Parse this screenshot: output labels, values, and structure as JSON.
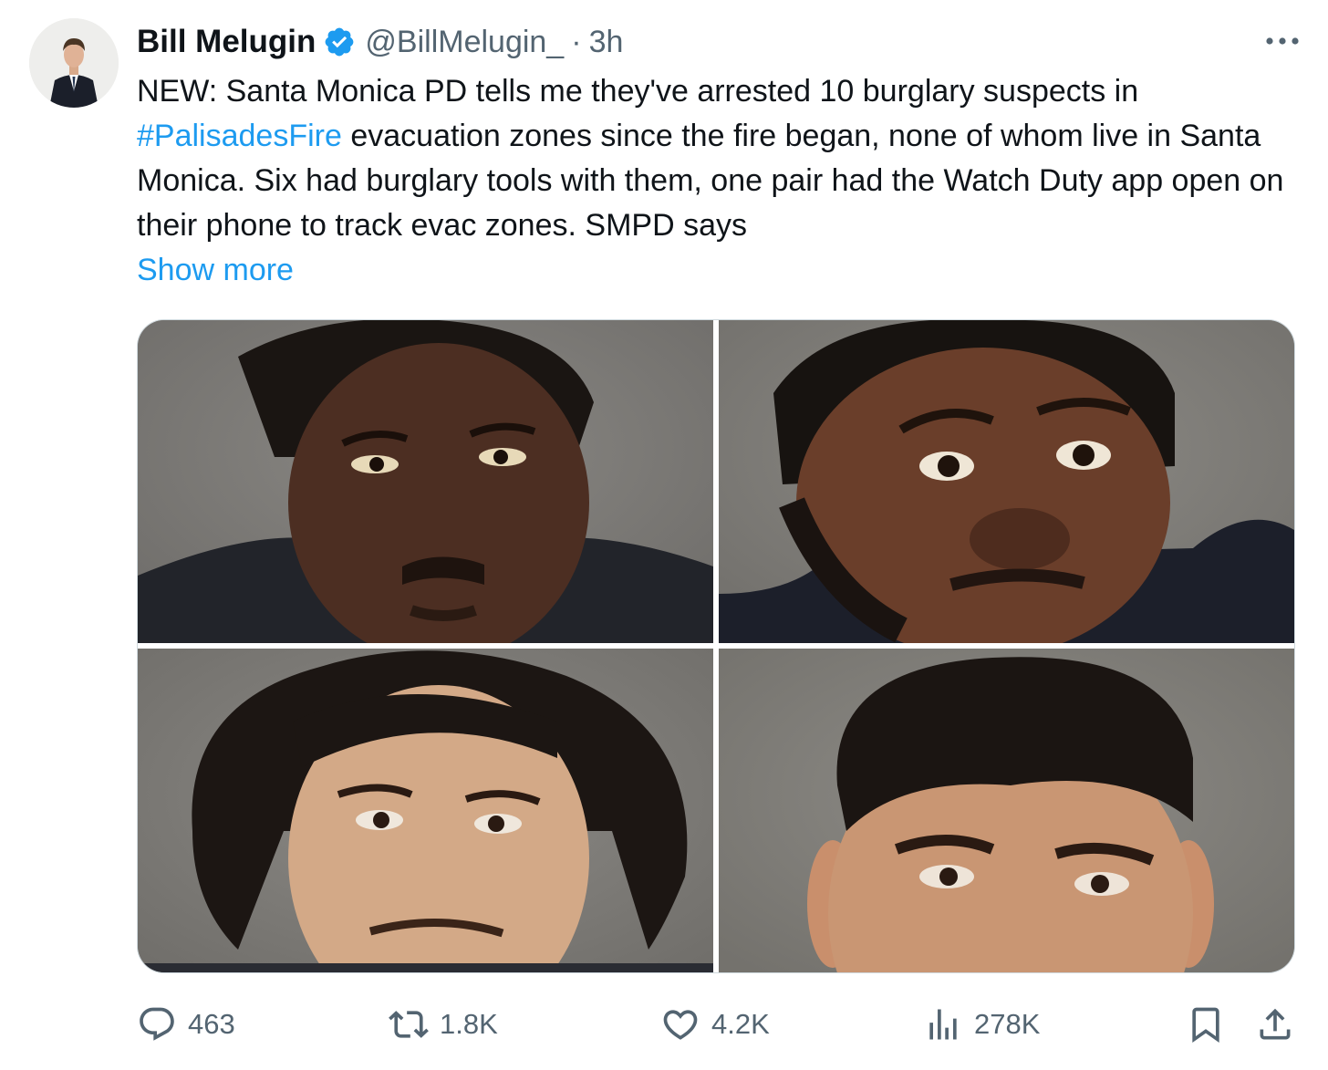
{
  "author": {
    "name": "Bill Melugin",
    "handle": "@BillMelugin_",
    "separator": "·",
    "time": "3h",
    "verified_icon": "verified-badge-icon"
  },
  "tweet": {
    "text_part1": "NEW: Santa Monica PD tells me they've arrested 10 burglary suspects in ",
    "hashtag": "#PalisadesFire",
    "text_part2": " evacuation zones since the fire began, none of whom live in Santa Monica. Six had burglary tools with them, one pair had the Watch Duty app open on their phone to track evac zones. SMPD says",
    "show_more": "Show more"
  },
  "actions": {
    "replies": "463",
    "reposts": "1.8K",
    "likes": "4.2K",
    "views": "278K"
  },
  "colors": {
    "link": "#1d9bf0",
    "secondary": "#536471",
    "text": "#0f1419",
    "border": "#cfd9de"
  }
}
